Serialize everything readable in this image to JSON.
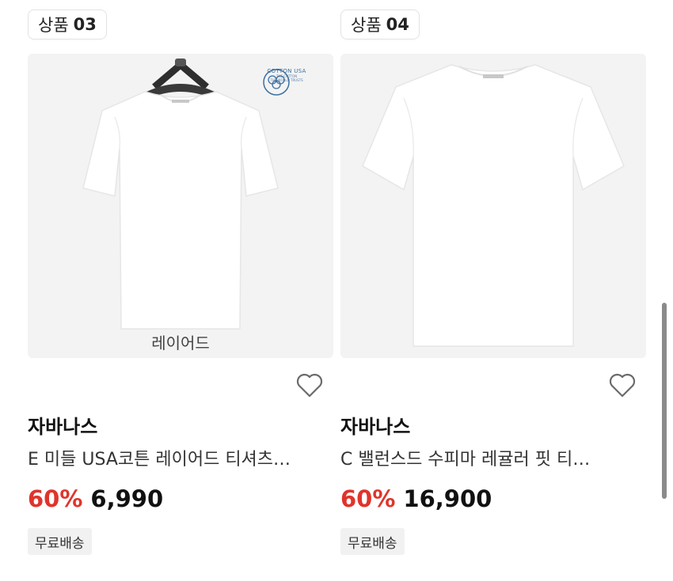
{
  "products": [
    {
      "badge_label": "상품",
      "badge_number": "03",
      "image_overlay": "레이어드",
      "cotton_logo": {
        "title": "COTTON USA",
        "line1": "THE COTTON",
        "line2": "THE WORLD TRUSTS"
      },
      "brand": "자바나스",
      "title": "E 미들 USA코튼 레이어드 티셔츠…",
      "discount": "60%",
      "price": "6,990",
      "shipping_tag": "무료배송",
      "wishlist_icon": "heart-outline-icon"
    },
    {
      "badge_label": "상품",
      "badge_number": "04",
      "brand": "자바나스",
      "title": "C 밸런스드 수피마 레귤러 핏 티…",
      "discount": "60%",
      "price": "16,900",
      "shipping_tag": "무료배송",
      "wishlist_icon": "heart-outline-icon"
    }
  ],
  "colors": {
    "discount": "#e0342b",
    "image_bg": "#f3f3f3",
    "tag_bg": "#f1f1f1"
  }
}
